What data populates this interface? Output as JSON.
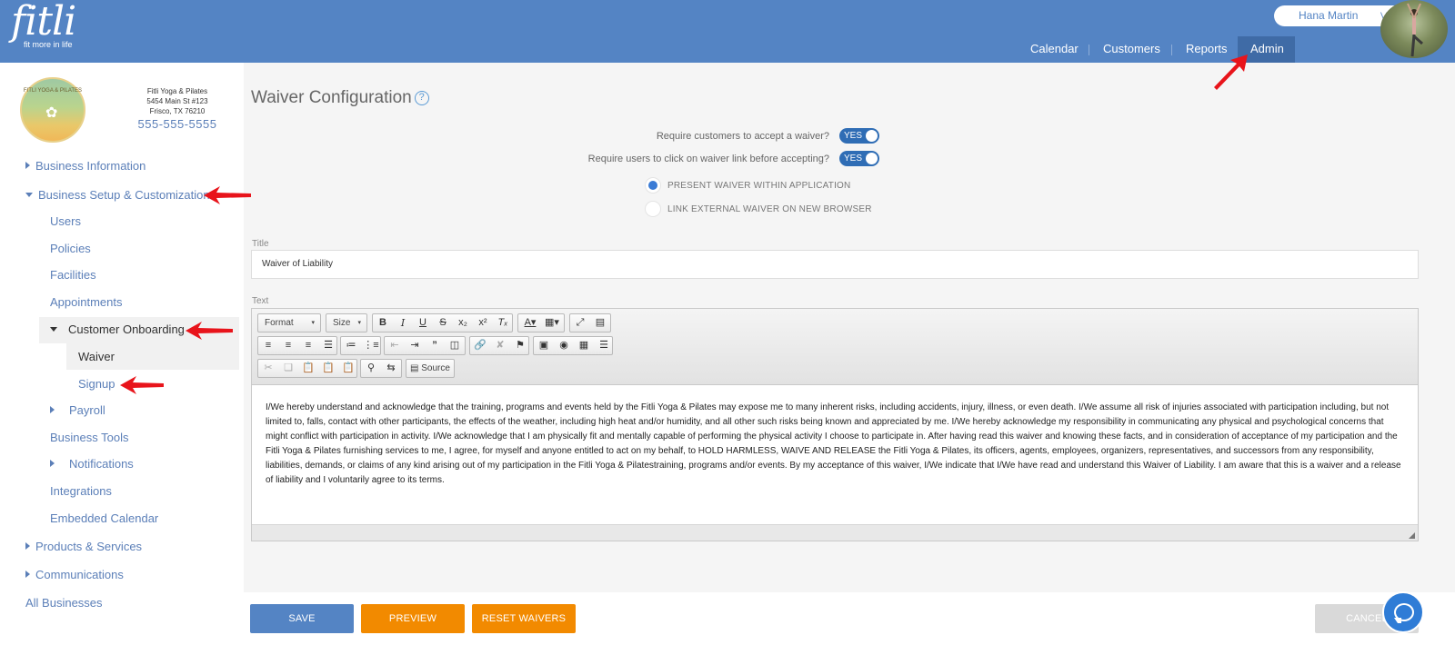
{
  "app": {
    "logo_text": "fitli",
    "logo_tagline": "fit more in life"
  },
  "header": {
    "user_name": "Hana Martin",
    "nav": [
      "Calendar",
      "Customers",
      "Reports",
      "Admin"
    ],
    "active_nav": "Admin"
  },
  "business": {
    "logo_text": "FITLI YOGA & PILATES",
    "name": "Fitli Yoga & Pilates",
    "address1": "5454 Main St #123",
    "address2": "Frisco, TX 76210",
    "phone": "555-555-5555"
  },
  "sidebar": {
    "business_information": "Business Information",
    "business_setup": "Business Setup & Customization",
    "users": "Users",
    "policies": "Policies",
    "facilities": "Facilities",
    "appointments": "Appointments",
    "customer_onboarding": "Customer Onboarding",
    "waiver": "Waiver",
    "signup": "Signup",
    "payroll": "Payroll",
    "business_tools": "Business Tools",
    "notifications": "Notifications",
    "integrations": "Integrations",
    "embedded_calendar": "Embedded Calendar",
    "products_services": "Products & Services",
    "communications": "Communications",
    "all_businesses": "All Businesses"
  },
  "main": {
    "title": "Waiver Configuration",
    "require_accept_label": "Require customers to accept a waiver?",
    "require_accept_value": "YES",
    "require_click_label": "Require users to click on waiver link before accepting?",
    "require_click_value": "YES",
    "radio_present": "PRESENT WAIVER WITHIN APPLICATION",
    "radio_link": "LINK EXTERNAL WAIVER ON NEW BROWSER",
    "title_label": "Title",
    "title_value": "Waiver of Liability",
    "text_label": "Text",
    "format_label": "Format",
    "size_label": "Size",
    "source_label": "Source",
    "body_text": "I/We hereby understand and acknowledge that the training, programs and events held by the Fitli Yoga & Pilates may expose me to many inherent risks, including accidents, injury, illness, or even death. I/We assume all risk of injuries associated with participation including, but not limited to, falls, contact with other participants, the effects of the weather, including high heat and/or humidity, and all other such risks being known and appreciated by me. I/We hereby acknowledge my responsibility in communicating any physical and psychological concerns that might conflict with participation in activity. I/We acknowledge that I am physically fit and mentally capable of performing the physical activity I choose to participate in. After having read this waiver and knowing these facts, and in consideration of acceptance of my participation and the Fitli Yoga & Pilates furnishing services to me, I agree, for myself and anyone entitled to act on my behalf, to HOLD HARMLESS, WAIVE AND RELEASE the Fitli Yoga & Pilates, its officers, agents, employees, organizers, representatives, and successors from any responsibility, liabilities, demands, or claims of any kind arising out of my participation in the Fitli Yoga & Pilatestraining, programs and/or events. By my acceptance of this waiver, I/We indicate that I/We have read and understand this Waiver of Liability. I am aware that this is a waiver and a release of liability and I voluntarily agree to its terms."
  },
  "buttons": {
    "save": "SAVE",
    "preview": "PREVIEW",
    "reset": "RESET WAIVERS",
    "cancel": "CANCEL"
  },
  "colors": {
    "header_blue": "#5484c4",
    "active_nav": "#3f6ba6",
    "accent_orange": "#f28a00",
    "toggle_blue": "#2f6db5",
    "annotation_red": "#e8141b"
  }
}
